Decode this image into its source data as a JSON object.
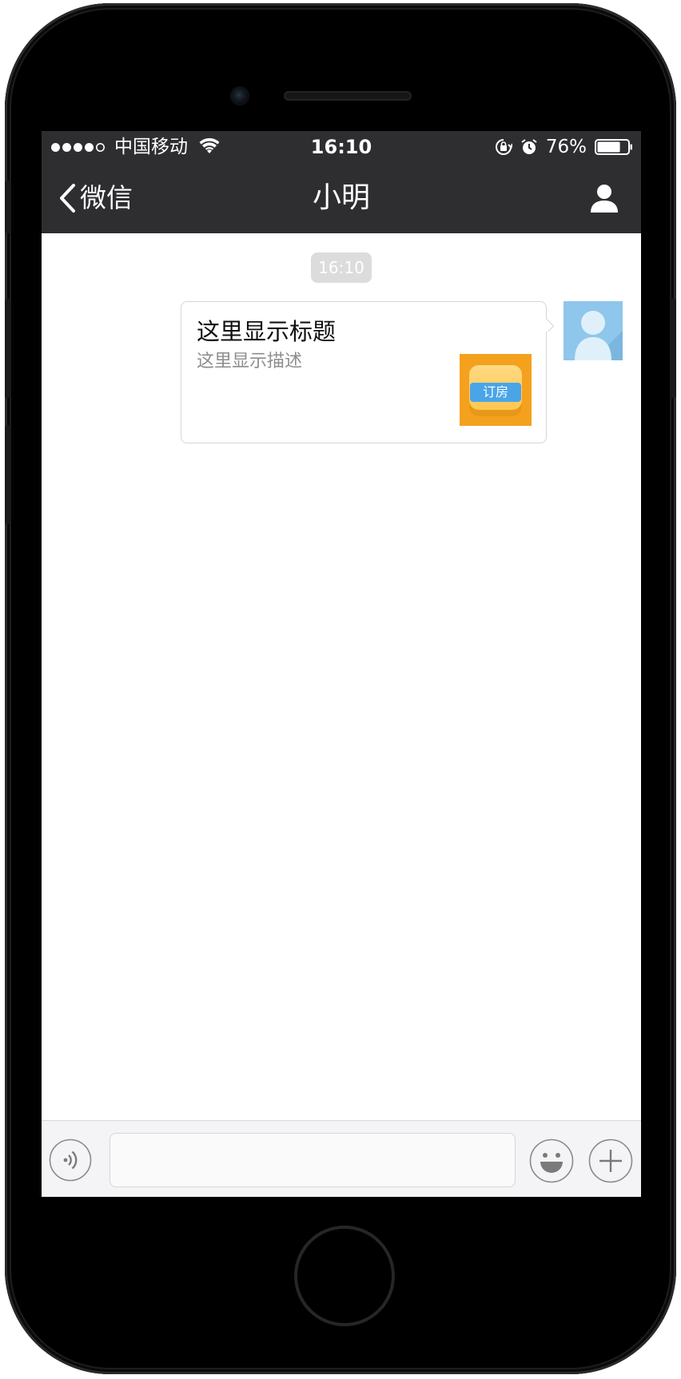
{
  "status_bar": {
    "carrier": "中国移动",
    "time": "16:10",
    "battery": "76%",
    "signal_filled": 4,
    "signal_total": 5,
    "battery_level": 0.76,
    "icons": [
      "wifi-icon",
      "rotation-lock-icon",
      "alarm-icon",
      "battery-icon"
    ]
  },
  "nav": {
    "back_label": "微信",
    "title": "小明",
    "right_icon": "person-icon"
  },
  "chat": {
    "timestamp": "16:10",
    "message": {
      "title": "这里显示标题",
      "description": "这里显示描述",
      "thumbnail_label": "订房"
    }
  },
  "input_bar": {
    "value": "",
    "placeholder": "",
    "icons": [
      "voice-icon",
      "emoji-icon",
      "plus-icon"
    ]
  },
  "colors": {
    "nav_bg": "#2e2e30",
    "bubble_border": "#d6d6d6",
    "avatar": "#8fc6eb",
    "thumb_bg": "#f4a11e",
    "thumb_label": "#4aa5e8"
  }
}
